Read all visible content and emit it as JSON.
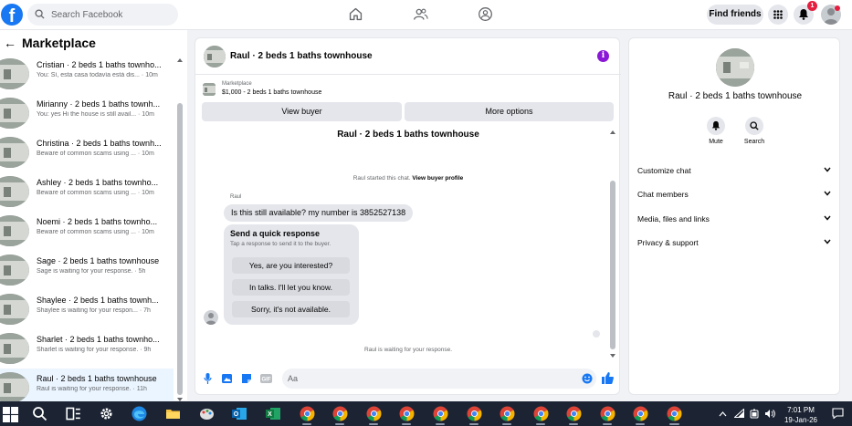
{
  "topbar": {
    "search_placeholder": "Search Facebook",
    "find_friends_label": "Find friends",
    "notification_count": "1"
  },
  "left_panel": {
    "title": "Marketplace",
    "conversations": [
      {
        "name": "Cristian · 2 beds 1 baths townho...",
        "preview": "You: Sí, esta casa todavía está dis... · 10m",
        "active": false
      },
      {
        "name": "Mirianny · 2 beds 1 baths townh...",
        "preview": "You: yes Hi the house is still avail... · 10m",
        "active": false
      },
      {
        "name": "Christina · 2 beds 1 baths townh...",
        "preview": "Beware of common scams using ... · 10m",
        "active": false
      },
      {
        "name": "Ashley · 2 beds 1 baths townho...",
        "preview": "Beware of common scams using ... · 10m",
        "active": false
      },
      {
        "name": "Noemi · 2 beds 1 baths townho...",
        "preview": "Beware of common scams using ... · 10m",
        "active": false
      },
      {
        "name": "Sage · 2 beds 1 baths townhouse",
        "preview": "Sage is waiting for your response. · 5h",
        "active": false
      },
      {
        "name": "Shaylee · 2 beds 1 baths townh...",
        "preview": "Shaylee is waiting for your respon... · 7h",
        "active": false
      },
      {
        "name": "Sharlet · 2 beds 1 baths townho...",
        "preview": "Sharlet is waiting for your response. · 9h",
        "active": false
      },
      {
        "name": "Raul · 2 beds 1 baths townhouse",
        "preview": "Raul is waiting for your response. · 11h",
        "active": true
      }
    ]
  },
  "chat": {
    "header_title": "Raul · 2 beds 1 baths townhouse",
    "marketplace_label": "Marketplace",
    "listing_price_title": "$1,000 - 2 beds 1 baths townhouse",
    "view_buyer_label": "View buyer",
    "more_options_label": "More options",
    "body_title": "Raul · 2 beds 1 baths townhouse",
    "system_message": "Raul started this chat.",
    "system_link": "View buyer profile",
    "sender_name": "Raul",
    "message": "Is this still available? my number is 3852527138",
    "quick_response_title": "Send a quick response",
    "quick_response_subtitle": "Tap a response to send it to the buyer.",
    "quick_responses": [
      "Yes, are you interested?",
      "In talks. I'll let you know.",
      "Sorry, it's not available."
    ],
    "waiting_text": "Raul is waiting for your response.",
    "composer_placeholder": "Aa"
  },
  "details": {
    "title": "Raul · 2 beds 1 baths townhouse",
    "mute_label": "Mute",
    "search_label": "Search",
    "sections": [
      "Customize chat",
      "Chat members",
      "Media, files and links",
      "Privacy & support"
    ]
  },
  "taskbar": {
    "time": "7:01 PM",
    "date": "19-Jan-26"
  },
  "colors": {
    "facebook_blue": "#1877f2",
    "info_purple": "#8b18d6",
    "badge_red": "#e41e3f",
    "taskbar_bg": "#1c2434"
  }
}
